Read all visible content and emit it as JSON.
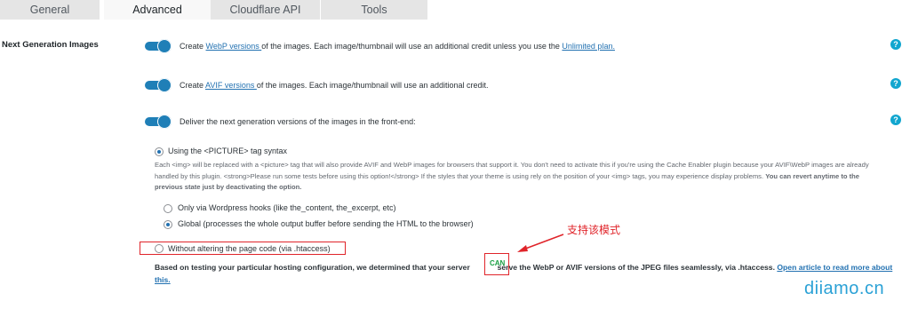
{
  "tabs": [
    {
      "label": "General"
    },
    {
      "label": "Advanced",
      "active": true
    },
    {
      "label": "Cloudflare API"
    },
    {
      "label": "Tools"
    }
  ],
  "section": {
    "label": "Next Generation Images"
  },
  "options": {
    "webp": {
      "pre": "Create ",
      "link": "WebP versions ",
      "mid": "of the images. Each image/thumbnail will use an additional credit unless you use the ",
      "link2": "Unlimited plan.",
      "enabled": true
    },
    "avif": {
      "pre": "Create ",
      "link": "AVIF versions ",
      "mid": "of the images. Each image/thumbnail will use an additional credit.",
      "enabled": true
    },
    "deliver": {
      "text": "Deliver the next generation versions of the images in the front-end:",
      "enabled": true
    }
  },
  "delivery": {
    "picture": {
      "label": "Using the <PICTURE> tag syntax",
      "checked": true,
      "description": "Each <img> will be replaced with a <picture> tag that will also provide AVIF and WebP images for browsers that support it. You don't need to activate this if you're using the Cache Enabler plugin because your AVIF\\WebP images are already handled by this plugin. <strong>Please run some tests before using this option!</strong> If the styles that your theme is using rely on the position of your <img> tags, you may experience display problems.",
      "description_bold": "You can revert anytime to the previous state just by deactivating the option."
    },
    "hooks": {
      "label": "Only via Wordpress hooks (like the_content, the_excerpt, etc)",
      "checked": false
    },
    "global": {
      "label": "Global (processes the whole output buffer before sending the HTML to the browser)",
      "checked": true
    },
    "htaccess": {
      "label": "Without altering the page code (via .htaccess)",
      "checked": false
    }
  },
  "result": {
    "pre": "Based on testing your particular hosting configuration, we determined that your server ",
    "badge": "CAN",
    "post": " serve the WebP or AVIF versions of the JPEG files seamlessly, via .htaccess. ",
    "link": "Open article to read more about this."
  },
  "annotation": {
    "text": "支持该模式"
  },
  "watermark": {
    "text": "diiamo.cn"
  },
  "help_icon": {
    "glyph": "?"
  },
  "colors": {
    "accent": "#1f7fb7",
    "help": "#11a6cf",
    "annotation": "#e0242a",
    "badge": "#1a9e43",
    "watermark": "#2aa1d6"
  }
}
